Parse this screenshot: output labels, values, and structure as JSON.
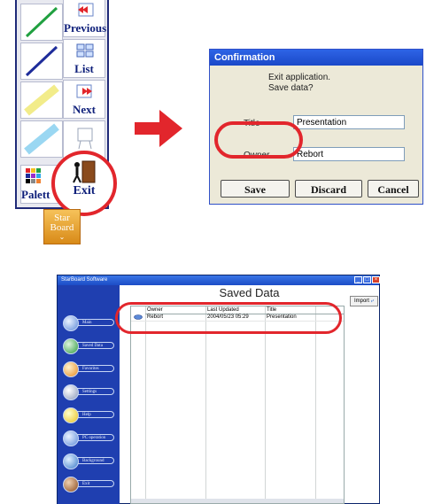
{
  "toolbar": {
    "buttons": [
      {
        "label": "Previous",
        "icon": "previous-icon"
      },
      {
        "label": "List",
        "icon": "list-icon"
      },
      {
        "label": "Next",
        "icon": "next-icon"
      },
      {
        "label": "",
        "icon": "board-icon"
      }
    ],
    "palette_label": "Palett",
    "exit_label": "Exit",
    "logo_line1": "Star",
    "logo_line2": "Board"
  },
  "dialog": {
    "title": "Confirmation",
    "message_line1": "Exit application.",
    "message_line2": "Save data?",
    "title_label": "Title",
    "title_value": "Presentation",
    "owner_label": "Owner",
    "owner_value": "Rebort",
    "save_label": "Save",
    "discard_label": "Discard",
    "cancel_label": "Cancel"
  },
  "window": {
    "app_title": "StarBoard Software",
    "heading": "Saved Data",
    "import_label": "Import",
    "sidebar": [
      "Main",
      "Saved Data",
      "Favorites",
      "Settings",
      "Help",
      "PC operation",
      "Background",
      "Exit"
    ],
    "columns": [
      "Owner",
      "Last Updated",
      "Title"
    ],
    "rows": [
      {
        "owner": "Rebort",
        "updated": "2004/05/23 05:29",
        "title": "Presentation"
      }
    ]
  },
  "colors": {
    "highlight": "#e2262c",
    "titlebar": "#1c4cc6",
    "sidebar": "#1f3fb0"
  }
}
